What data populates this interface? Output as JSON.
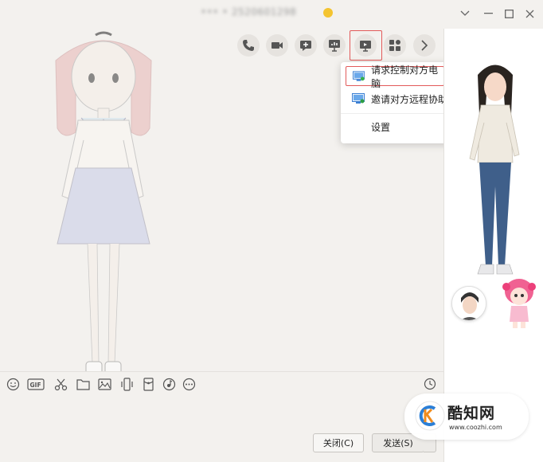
{
  "window": {
    "title": "••• • 2520601298",
    "controls": [
      "minimize",
      "maximize",
      "close"
    ]
  },
  "toolbar": {
    "buttons": [
      {
        "name": "voice-call",
        "icon": "phone-icon"
      },
      {
        "name": "video-call",
        "icon": "video-icon"
      },
      {
        "name": "new-chat",
        "icon": "chat-plus-icon"
      },
      {
        "name": "present",
        "icon": "presentation-icon"
      },
      {
        "name": "remote-desktop",
        "icon": "screen-icon"
      },
      {
        "name": "apps",
        "icon": "apps-icon"
      },
      {
        "name": "more",
        "icon": "chevron-right-icon"
      }
    ]
  },
  "remote_menu": {
    "items": [
      {
        "label": "请求控制对方电脑",
        "icon": "remote-control-icon"
      },
      {
        "label": "邀请对方远程协助",
        "icon": "remote-assist-icon"
      },
      {
        "label": "设置"
      }
    ]
  },
  "input_toolbar": {
    "tools": [
      "emoji-icon",
      "gif-icon",
      "scissors-icon",
      "folder-icon",
      "image-icon",
      "shake-icon",
      "red-packet-icon",
      "music-icon",
      "more-icon"
    ],
    "history": "clock-icon"
  },
  "buttons": {
    "close_label": "关闭(C)",
    "send_label": "发送(S)"
  },
  "watermark": {
    "title": "酷知网",
    "url": "www.coozhi.com"
  },
  "colors": {
    "highlight": "#e25a5a",
    "background": "#f3f1ee",
    "panel": "#ffffff"
  }
}
